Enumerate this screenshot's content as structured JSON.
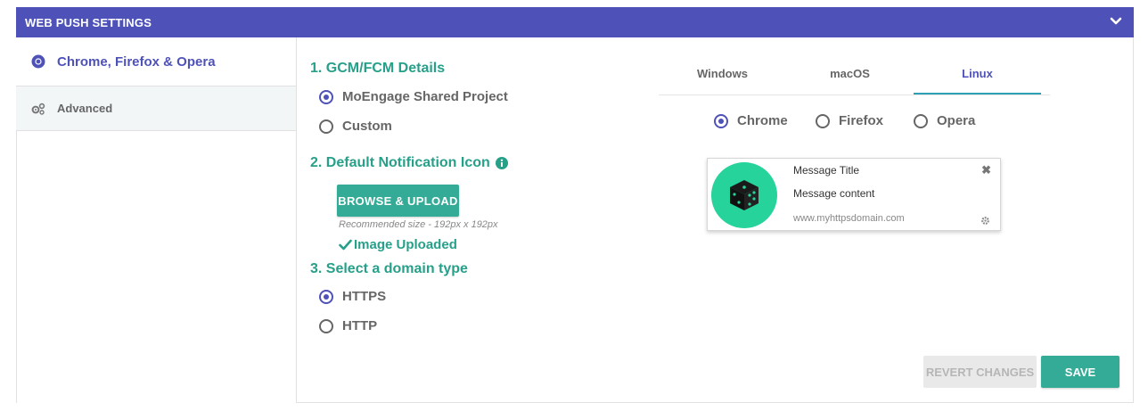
{
  "header": {
    "title": "WEB PUSH SETTINGS",
    "toggle_icon": "chevron-down-icon"
  },
  "sidebar": {
    "items": [
      {
        "label": "Chrome, Firefox & Opera",
        "icon": "chrome-icon",
        "active": true
      },
      {
        "label": "Advanced",
        "icon": "gears-icon",
        "active": false
      }
    ]
  },
  "section1": {
    "title": "1. GCM/FCM Details",
    "options": [
      {
        "label": "MoEngage Shared Project",
        "selected": true
      },
      {
        "label": "Custom",
        "selected": false
      }
    ]
  },
  "section2": {
    "title": "2. Default Notification Icon",
    "info_icon": "info-circle-icon",
    "upload_label": "BROWSE & UPLOAD",
    "recommended": "Recommended size - 192px x 192px",
    "status": "Image Uploaded"
  },
  "section3": {
    "title": "3. Select a domain type",
    "options": [
      {
        "label": "HTTPS",
        "selected": true
      },
      {
        "label": "HTTP",
        "selected": false
      }
    ]
  },
  "preview": {
    "tabs": [
      "Windows",
      "macOS",
      "Linux"
    ],
    "active_tab": "Linux",
    "browsers": [
      {
        "label": "Chrome",
        "selected": true
      },
      {
        "label": "Firefox",
        "selected": false
      },
      {
        "label": "Opera",
        "selected": false
      }
    ],
    "notification": {
      "title": "Message Title",
      "content": "Message content",
      "domain": "www.myhttpsdomain.com",
      "icon": "dice-icon",
      "icon_bg": "#25d39b"
    }
  },
  "actions": {
    "revert_label": "REVERT CHANGES",
    "save_label": "SAVE"
  },
  "colors": {
    "header": "#4e52b8",
    "accent": "#33ab96",
    "title_green": "#27a08a"
  }
}
